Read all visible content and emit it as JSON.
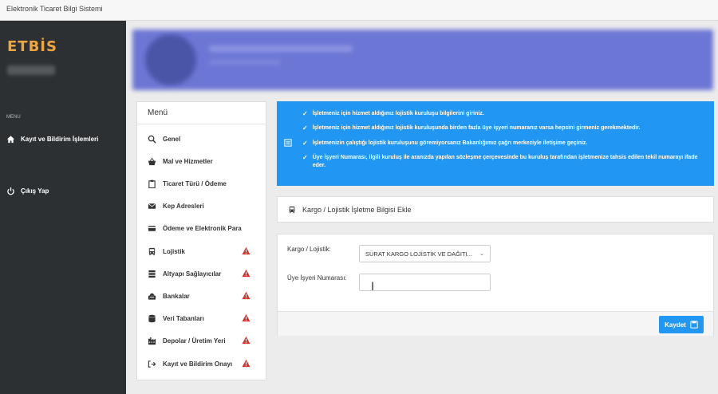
{
  "window": {
    "title": "Elektronik Ticaret Bilgi Sistemi"
  },
  "sidebar": {
    "logo": "ETBİS",
    "menu_caption": "MENU",
    "items": [
      {
        "label": "Kayıt ve Bildirim İşlemleri",
        "icon": "home-icon"
      },
      {
        "label": "Çıkış Yap",
        "icon": "power-icon"
      }
    ]
  },
  "menu": {
    "title": "Menü",
    "items": [
      {
        "label": "Genel",
        "icon": "search-icon",
        "warning": false
      },
      {
        "label": "Mal ve Hizmetler",
        "icon": "basket-icon",
        "warning": false
      },
      {
        "label": "Ticaret Türü / Ödeme",
        "icon": "clipboard-icon",
        "warning": false
      },
      {
        "label": "Kep Adresleri",
        "icon": "envelope-icon",
        "warning": false
      },
      {
        "label": "Ödeme ve Elektronik Para",
        "icon": "credit-card-icon",
        "warning": false
      },
      {
        "label": "Lojistik",
        "icon": "bus-icon",
        "warning": true
      },
      {
        "label": "Altyapı Sağlayıcılar",
        "icon": "server-icon",
        "warning": true
      },
      {
        "label": "Bankalar",
        "icon": "bank-icon",
        "warning": true
      },
      {
        "label": "Veri Tabanları",
        "icon": "database-icon",
        "warning": true
      },
      {
        "label": "Depolar / Üretim Yeri",
        "icon": "factory-icon",
        "warning": true
      },
      {
        "label": "Kayıt ve Bildirim Onayı",
        "icon": "sign-in-icon",
        "warning": true
      }
    ]
  },
  "info": {
    "lines": [
      "İşletmeniz için hizmet aldığınız lojistik kuruluşu bilgilerini giriniz.",
      "İşletmeniz için hizmet aldığınız lojistik kuruluşunda birden fazla üye işyeri numaranız varsa hepsini girmeniz gerekmektedir.",
      "İşletmenizin çalıştığı lojistik kuruluşunu göremiyorsanız Bakanlığımız çağrı merkeziyle iletişime geçiniz.",
      "Üye İşyeri Numarası, ilgili kuruluş ile aranızda yapılan sözleşme çerçevesinde bu kuruluş tarafından işletmenize tahsis edilen tekil numarayı ifade eder."
    ]
  },
  "cargo": {
    "header": "Kargo / Lojistik İşletme Bilgisi Ekle",
    "label_cargo": "Kargo / Lojistik:",
    "selected_cargo": "SÜRAT KARGO LOJİSTİK VE DAĞITI...",
    "label_member_no": "Üye İşyeri Numarası:",
    "member_no_value": "",
    "save_label": "Kaydet"
  }
}
